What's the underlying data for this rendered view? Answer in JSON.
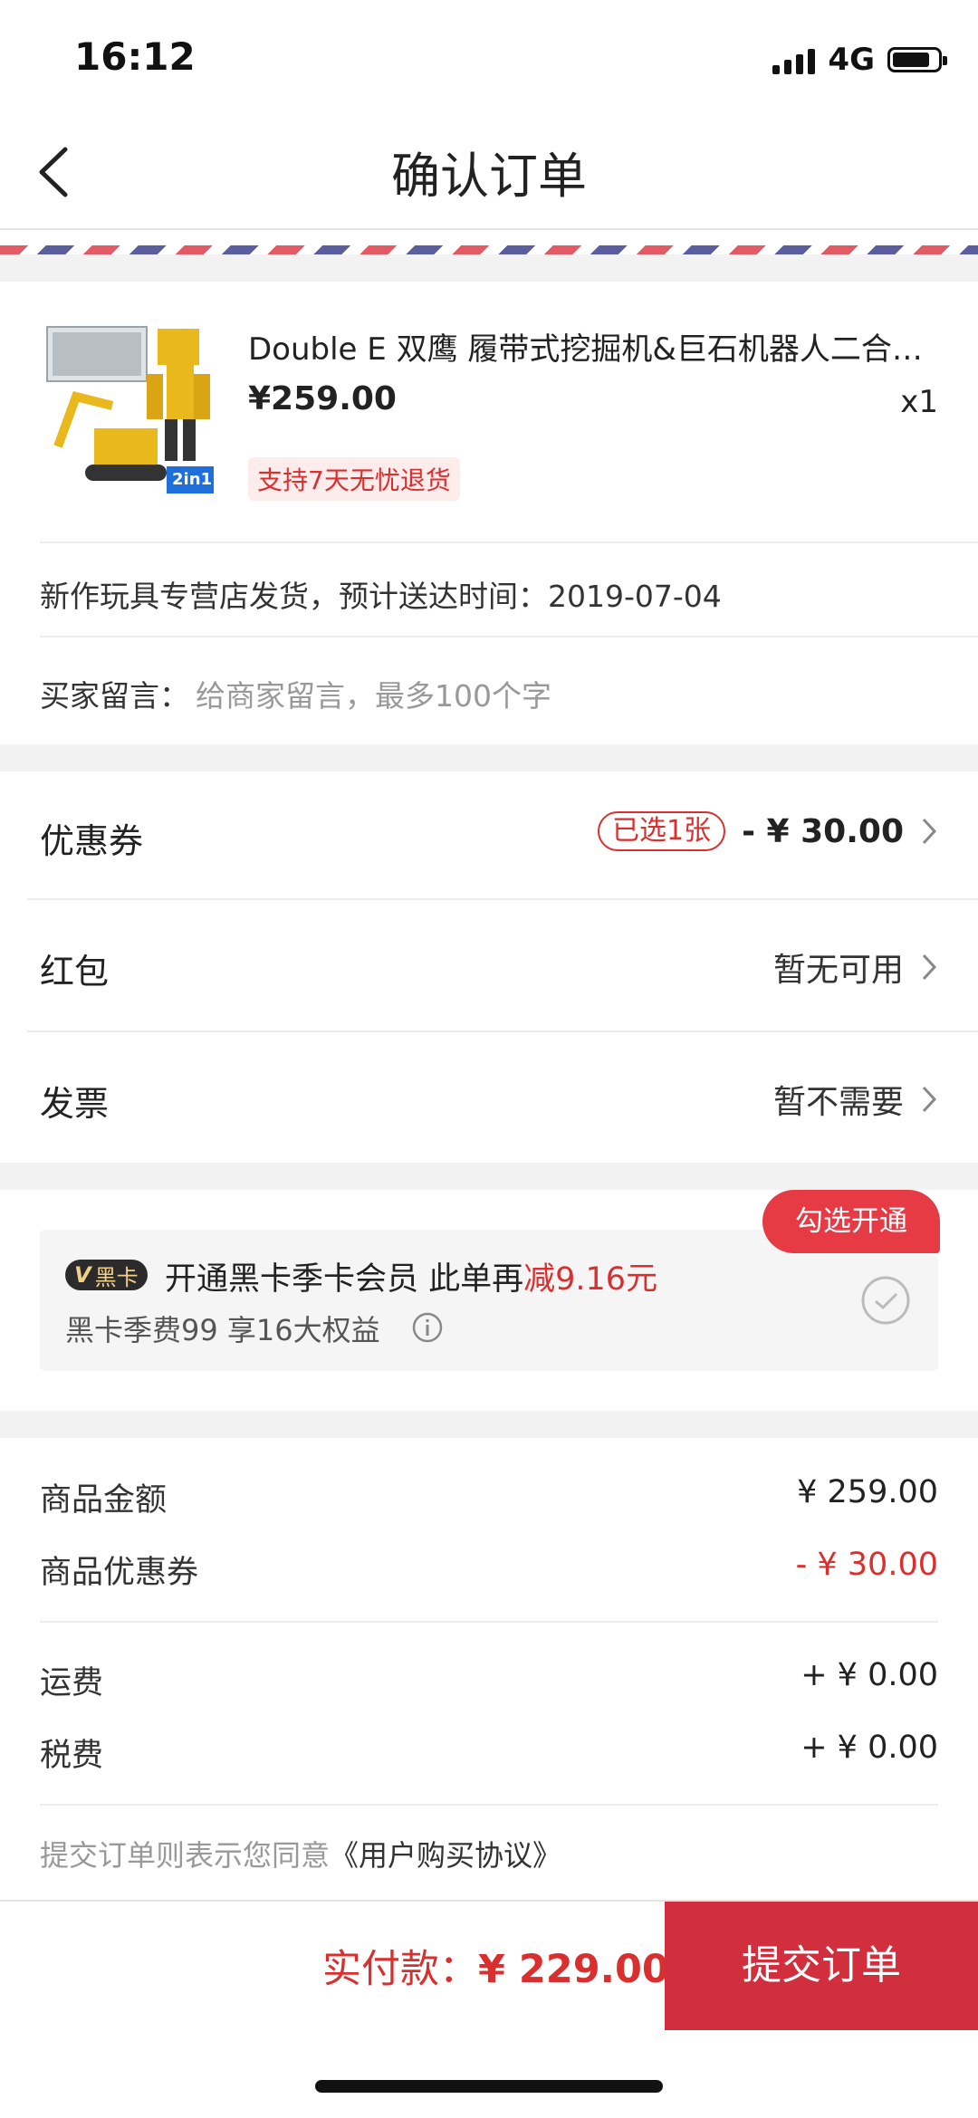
{
  "status": {
    "time": "16:12",
    "network": "4G"
  },
  "nav": {
    "title": "确认订单"
  },
  "product": {
    "title": "Double E 双鹰 履带式挖掘机&巨石机器人二合…",
    "price": "¥259.00",
    "qty": "x1",
    "tag": "支持7天无忧退货",
    "thumb_label": "2in1"
  },
  "shipping": {
    "text": "新作玩具专营店发货，预计送达时间：2019-07-04"
  },
  "message": {
    "label": "买家留言：",
    "placeholder": "给商家留言，最多100个字"
  },
  "rows": {
    "coupon": {
      "label": "优惠券",
      "badge": "已选1张",
      "value": "- ¥ 30.00"
    },
    "redpacket": {
      "label": "红包",
      "value": "暂无可用"
    },
    "invoice": {
      "label": "发票",
      "value": "暂不需要"
    }
  },
  "blackcard": {
    "bubble": "勾选开通",
    "chip": "黑卡",
    "main_prefix": "开通黑卡季卡会员 此单再",
    "main_red": "减9.16元",
    "sub": "黑卡季费99 享16大权益"
  },
  "summary": {
    "goods_label": "商品金额",
    "goods_value": "¥ 259.00",
    "coupon_label": "商品优惠券",
    "coupon_value": "- ¥ 30.00",
    "freight_label": "运费",
    "freight_value": "+ ¥ 0.00",
    "tax_label": "税费",
    "tax_value": "+ ¥ 0.00",
    "agree_prefix": "提交订单则表示您同意",
    "agree_link": "《用户购买协议》"
  },
  "footer": {
    "pay_label": "实付款：",
    "pay_amount": "¥ 229.00",
    "submit": "提交订单"
  },
  "colors": {
    "accent": "#d12f3d",
    "red_text": "#d9302f",
    "bg_gray": "#f2f2f2"
  }
}
